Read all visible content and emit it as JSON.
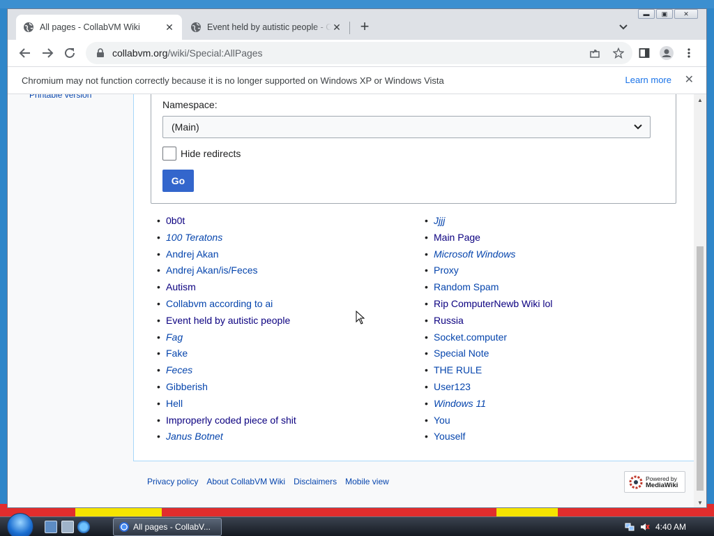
{
  "browser": {
    "tabs": [
      {
        "title": "All pages - CollabVM Wiki",
        "active": true
      },
      {
        "title": "Event held by autistic people - Co",
        "active": false
      }
    ],
    "url_host": "collabvm.org",
    "url_path": "/wiki/Special:AllPages",
    "infobar": {
      "message": "Chromium may not function correctly because it is no longer supported on Windows XP or Windows Vista",
      "learn_more": "Learn more"
    }
  },
  "sidebar": {
    "printable_version": "Printable version"
  },
  "form": {
    "namespace_label": "Namespace:",
    "namespace_value": "(Main)",
    "hide_redirects_label": "Hide redirects",
    "go_label": "Go"
  },
  "pages": {
    "left": [
      {
        "label": "0b0t",
        "style": "visited"
      },
      {
        "label": "100 Teratons",
        "style": "redirect"
      },
      {
        "label": "Andrej Akan",
        "style": "link"
      },
      {
        "label": "Andrej Akan/is/Feces",
        "style": "link"
      },
      {
        "label": "Autism",
        "style": "visited"
      },
      {
        "label": "Collabvm according to ai",
        "style": "link"
      },
      {
        "label": "Event held by autistic people",
        "style": "visited"
      },
      {
        "label": "Fag",
        "style": "redirect"
      },
      {
        "label": "Fake",
        "style": "link"
      },
      {
        "label": "Feces",
        "style": "redirect"
      },
      {
        "label": "Gibberish",
        "style": "link"
      },
      {
        "label": "Hell",
        "style": "link"
      },
      {
        "label": "Improperly coded piece of shit",
        "style": "visited"
      },
      {
        "label": "Janus Botnet",
        "style": "redirect"
      }
    ],
    "right": [
      {
        "label": "Jjjj",
        "style": "redirect"
      },
      {
        "label": "Main Page",
        "style": "visited"
      },
      {
        "label": "Microsoft Windows",
        "style": "redirect"
      },
      {
        "label": "Proxy",
        "style": "link"
      },
      {
        "label": "Random Spam",
        "style": "link"
      },
      {
        "label": "Rip ComputerNewb Wiki lol",
        "style": "visited"
      },
      {
        "label": "Russia",
        "style": "visited"
      },
      {
        "label": "Socket.computer",
        "style": "link"
      },
      {
        "label": "Special Note",
        "style": "link"
      },
      {
        "label": "THE RULE",
        "style": "link"
      },
      {
        "label": "User123",
        "style": "link"
      },
      {
        "label": "Windows 11",
        "style": "redirect"
      },
      {
        "label": "You",
        "style": "link"
      },
      {
        "label": "Youself",
        "style": "link"
      }
    ]
  },
  "footer": {
    "links": [
      "Privacy policy",
      "About CollabVM Wiki",
      "Disclaimers",
      "Mobile view"
    ],
    "powered_by_line1": "Powered by",
    "powered_by_line2": "MediaWiki"
  },
  "taskbar": {
    "task_label": "All pages - CollabV...",
    "clock": "4:40 AM"
  }
}
